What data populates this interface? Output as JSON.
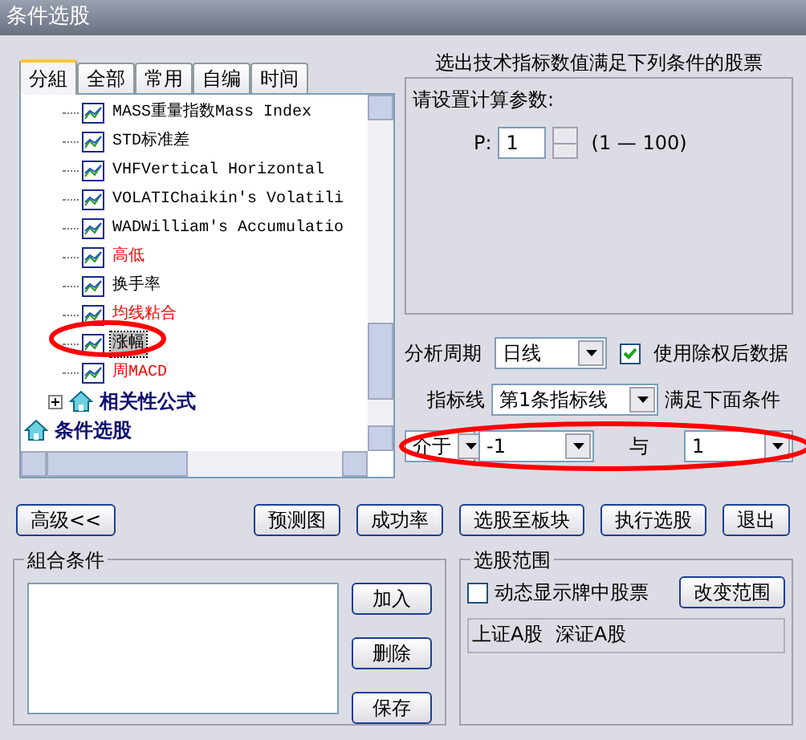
{
  "window": {
    "title": "条件选股"
  },
  "tabs": [
    {
      "label": "分組",
      "selected": true
    },
    {
      "label": "全部",
      "selected": false
    },
    {
      "label": "常用",
      "selected": false
    },
    {
      "label": "自编",
      "selected": false
    },
    {
      "label": "时间",
      "selected": false
    }
  ],
  "tree": {
    "items": [
      {
        "kind": "formula",
        "label": "MASS重量指数Mass Index",
        "color": "#000000",
        "selected": false
      },
      {
        "kind": "formula",
        "label": "STD标准差",
        "color": "#000000",
        "selected": false
      },
      {
        "kind": "formula",
        "label": "VHFVertical Horizontal",
        "color": "#000000",
        "selected": false
      },
      {
        "kind": "formula",
        "label": "VOLATIChaikin's Volatili",
        "color": "#000000",
        "selected": false
      },
      {
        "kind": "formula",
        "label": "WADWilliam's Accumulatio",
        "color": "#000000",
        "selected": false
      },
      {
        "kind": "formula",
        "label": "高低",
        "color": "#ff0000",
        "selected": false
      },
      {
        "kind": "formula",
        "label": "换手率",
        "color": "#000000",
        "selected": false
      },
      {
        "kind": "formula",
        "label": "均线粘合",
        "color": "#ff0000",
        "selected": false
      },
      {
        "kind": "formula",
        "label": "涨幅",
        "color": "#000000",
        "selected": true
      },
      {
        "kind": "formula",
        "label": "周MACD",
        "color": "#ff0000",
        "selected": false
      },
      {
        "kind": "group",
        "label": "相关性公式",
        "expanded": false
      },
      {
        "kind": "root",
        "label": "条件选股"
      }
    ]
  },
  "description": "选出技术指标数值满足下列条件的股票",
  "params": {
    "title": "请设置计算参数:",
    "label": "P:",
    "value": "1",
    "range": "(1 — 100)"
  },
  "period": {
    "label": "分析周期",
    "value": "日线"
  },
  "adjusted": {
    "label": "使用除权后数据",
    "checked": true
  },
  "indicator": {
    "label": "指标线",
    "value": "第1条指标线",
    "suffix": "满足下面条件"
  },
  "condition": {
    "operator": "介于",
    "low": "-1",
    "joiner": "与",
    "high": "1"
  },
  "buttons": [
    {
      "label": "高级<<"
    },
    {
      "label": "预测图"
    },
    {
      "label": "成功率"
    },
    {
      "label": "选股至板块"
    },
    {
      "label": "执行选股"
    },
    {
      "label": "退出"
    }
  ],
  "combo": {
    "title": "組合条件",
    "buttons": [
      "加入",
      "删除",
      "保存"
    ]
  },
  "scope": {
    "title": "选股范围",
    "dynamic": {
      "label": "动态显示牌中股票",
      "checked": false
    },
    "change_button": "改变范围",
    "markets": "上证A股  深证A股"
  }
}
